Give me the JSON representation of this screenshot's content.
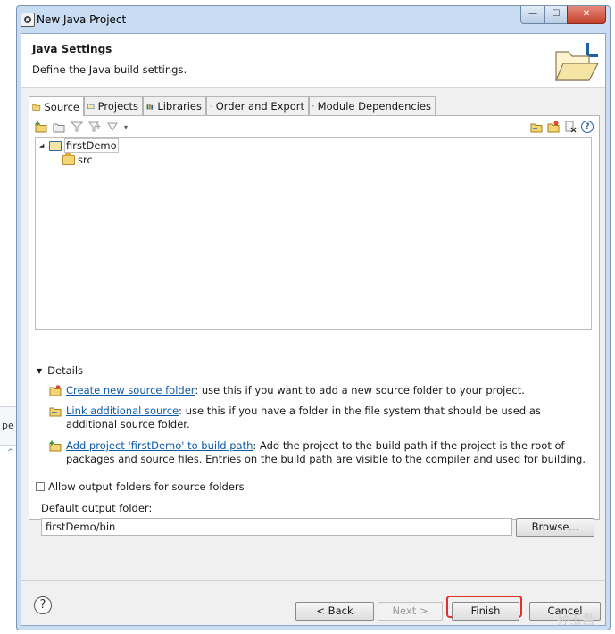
{
  "background": {
    "partial_text": "pe"
  },
  "window": {
    "title": "New Java Project",
    "minimize_label": "—",
    "maximize_label": "☐",
    "close_label": "✕"
  },
  "header": {
    "title": "Java Settings",
    "description": "Define the Java build settings."
  },
  "tabs": [
    {
      "label": "Source",
      "icon": "source-folder-icon",
      "active": true
    },
    {
      "label": "Projects",
      "icon": "projects-icon"
    },
    {
      "label": "Libraries",
      "icon": "libraries-icon"
    },
    {
      "label": "Order and Export",
      "icon": "order-export-icon"
    },
    {
      "label": "Module Dependencies",
      "icon": "module-dependencies-icon"
    }
  ],
  "tree": {
    "project": "firstDemo",
    "children": [
      "src"
    ]
  },
  "details": {
    "label": "Details",
    "items": [
      {
        "link": "Create new source folder",
        "text": ": use this if you want to add a new source folder to your project."
      },
      {
        "link": "Link additional source",
        "text": ": use this if you have a folder in the file system that should be used as additional source folder."
      },
      {
        "link": "Add project 'firstDemo' to build path",
        "text": ": Add the project to the build path if the project is the root of packages and source files. Entries on the build path are visible to the compiler and used for building."
      }
    ]
  },
  "options": {
    "allow_output_label": "Allow output folders for source folders",
    "default_output_label": "Default output folder:",
    "default_output_value": "firstDemo/bin",
    "browse_label": "Browse..."
  },
  "buttons": {
    "help": "?",
    "back": "< Back",
    "next": "Next >",
    "finish": "Finish",
    "cancel": "Cancel"
  },
  "watermark": "孙玉昌",
  "colors": {
    "link": "#0e5aa8",
    "highlight": "#e0322a"
  }
}
